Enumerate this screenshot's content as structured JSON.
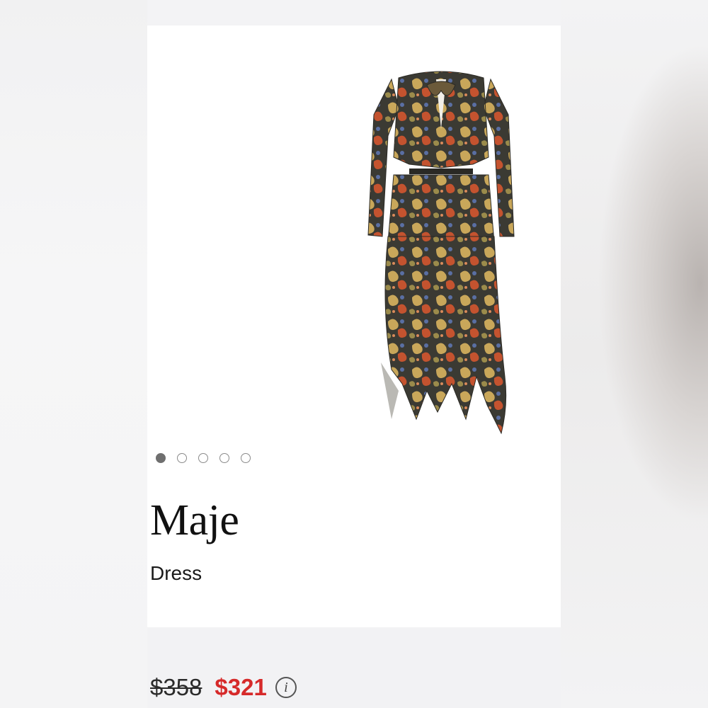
{
  "product": {
    "brand": "Maje",
    "category": "Dress",
    "image_icon": "paisley-dress-image"
  },
  "carousel": {
    "total": 5,
    "active": 1
  },
  "pricing": {
    "original_price": "$358",
    "sale_price": "$321",
    "info_icon": "i",
    "sale_color": "#d62a2a"
  }
}
